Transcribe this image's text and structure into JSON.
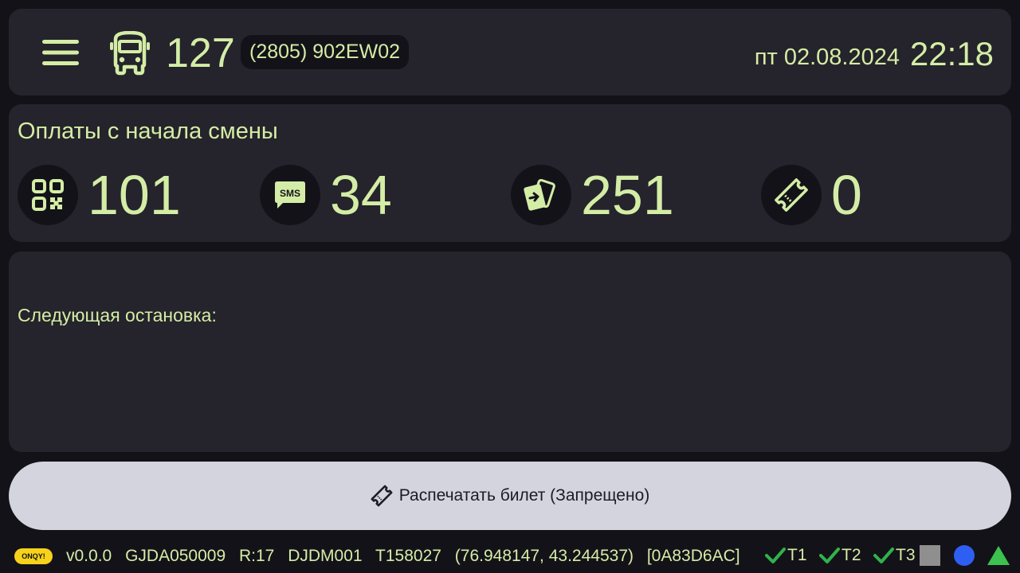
{
  "header": {
    "route_number": "127",
    "vehicle_id": "(2805) 902EW02",
    "date": "пт 02.08.2024",
    "time": "22:18"
  },
  "payments": {
    "title": "Оплаты с начала смены",
    "items": [
      {
        "icon": "qr-code-icon",
        "count": "101"
      },
      {
        "icon": "sms-icon",
        "count": "34"
      },
      {
        "icon": "card-icon",
        "count": "251"
      },
      {
        "icon": "ticket-icon",
        "count": "0"
      }
    ]
  },
  "next_stop": {
    "label": "Следующая остановка:"
  },
  "print_button": {
    "label": "Распечатать билет (Запрещено)"
  },
  "status_bar": {
    "badge": "ONQY!",
    "version": "v0.0.0",
    "device_id": "GJDA050009",
    "route_code": "R:17",
    "driver_code": "DJDM001",
    "terminal": "T158027",
    "coordinates": "(76.948147, 43.244537)",
    "hex_code": "[0A83D6AC]",
    "terminals": [
      "T1",
      "T2",
      "T3"
    ]
  },
  "colors": {
    "background": "#141219",
    "panel": "#25232b",
    "accent_text": "#d4eda6",
    "button": "#d4d4de",
    "check_green": "#2fb34a",
    "status_gray": "#8f8f8f",
    "status_blue": "#2f5ef2",
    "status_green": "#3cc24f",
    "badge_yellow": "#f6d21b"
  }
}
